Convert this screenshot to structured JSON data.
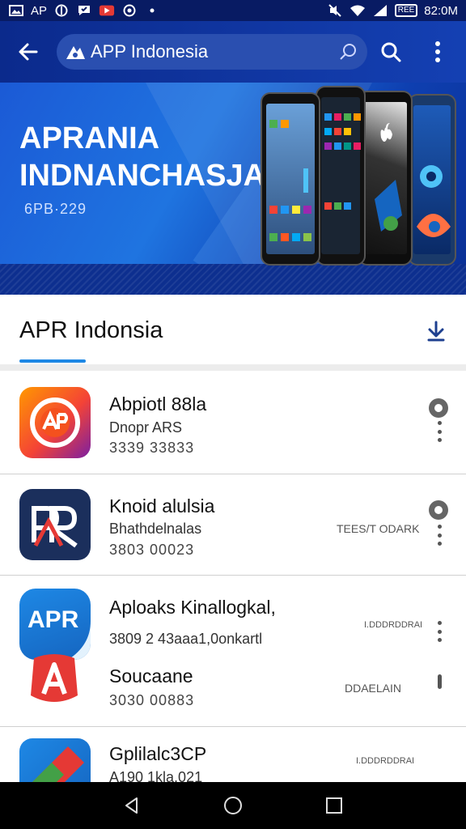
{
  "status_bar": {
    "left_text": "AP",
    "time": "82:0M",
    "box_label": "REE"
  },
  "app_bar": {
    "search_text": "APP Indonesia",
    "back_icon": "arrow-left-icon",
    "search_icon": "search-icon",
    "menu_icon": "more-vert-icon"
  },
  "banner": {
    "title_line1": "APRANIA",
    "title_line2": "INDNANCHASJA",
    "subtitle": "6PB·229"
  },
  "tab": {
    "title": "APR Indonsia",
    "download_icon": "download-icon"
  },
  "apps": [
    {
      "name": "Abpiotl 88la",
      "line2": "Dnopr ARS",
      "line3": "3339 33833",
      "tag": ""
    },
    {
      "name": "Knoid alulsia",
      "line2": "Bhathdelnalas",
      "line3": "3803 00023",
      "tag": "TEES/T ODARK"
    },
    {
      "name": "Aploaks Kinallogkal,",
      "line2": "3809 2 43aaa1,0onkartl",
      "line3": "",
      "tag": "I.DDDRDDRAI"
    },
    {
      "name": "Soucaane",
      "line2": "",
      "line3": "3030 00883",
      "tag": "DDAELAIN"
    },
    {
      "name": "Gplilalc3CP",
      "line2": "A190 1kla,021",
      "line3": "",
      "tag": "I.DDDRDDRAI"
    }
  ],
  "colors": {
    "primary": "#0b2a8c",
    "accent": "#1e88e5",
    "banner": "#1f74e0"
  }
}
